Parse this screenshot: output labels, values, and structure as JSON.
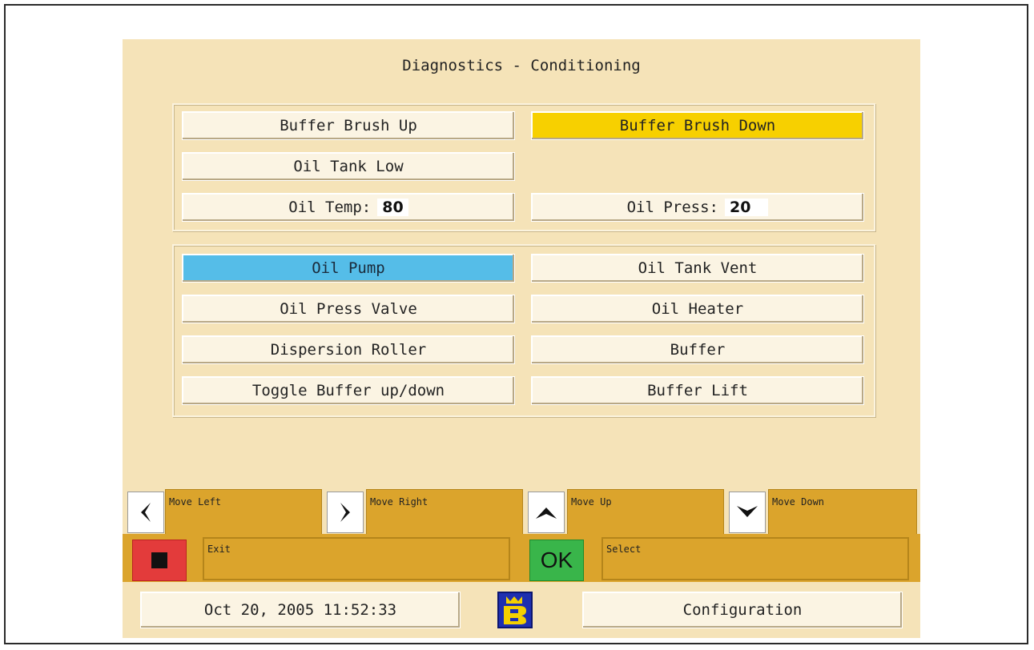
{
  "screen": {
    "title": "Diagnostics - Conditioning"
  },
  "status_panel": {
    "buffer_brush_up": "Buffer Brush Up",
    "buffer_brush_down": "Buffer Brush Down",
    "oil_tank_low": "Oil Tank Low",
    "oil_temp_label": "Oil Temp:",
    "oil_temp_value": "80",
    "oil_press_label": "Oil Press:",
    "oil_press_value": "20"
  },
  "control_panel": {
    "oil_pump": "Oil Pump",
    "oil_tank_vent": "Oil Tank Vent",
    "oil_press_valve": "Oil Press Valve",
    "oil_heater": "Oil Heater",
    "dispersion_roller": "Dispersion Roller",
    "buffer": "Buffer",
    "toggle_buffer": "Toggle Buffer up/down",
    "buffer_lift": "Buffer Lift"
  },
  "nav": {
    "move_left": "Move Left",
    "move_right": "Move Right",
    "move_up": "Move Up",
    "move_down": "Move Down"
  },
  "actions": {
    "exit": "Exit",
    "ok": "OK",
    "select": "Select"
  },
  "footer": {
    "datetime": "Oct 20, 2005 11:52:33",
    "configuration": "Configuration"
  },
  "colors": {
    "background": "#f5e3b8",
    "active_yellow": "#f7d000",
    "selected_blue": "#55bde8",
    "softkey_gold": "#dba42c",
    "exit_red": "#e33b3b",
    "ok_green": "#39b54a"
  },
  "icons": [
    "arrow-left-icon",
    "arrow-right-icon",
    "arrow-up-icon",
    "arrow-down-icon",
    "stop-icon",
    "logo-icon"
  ]
}
